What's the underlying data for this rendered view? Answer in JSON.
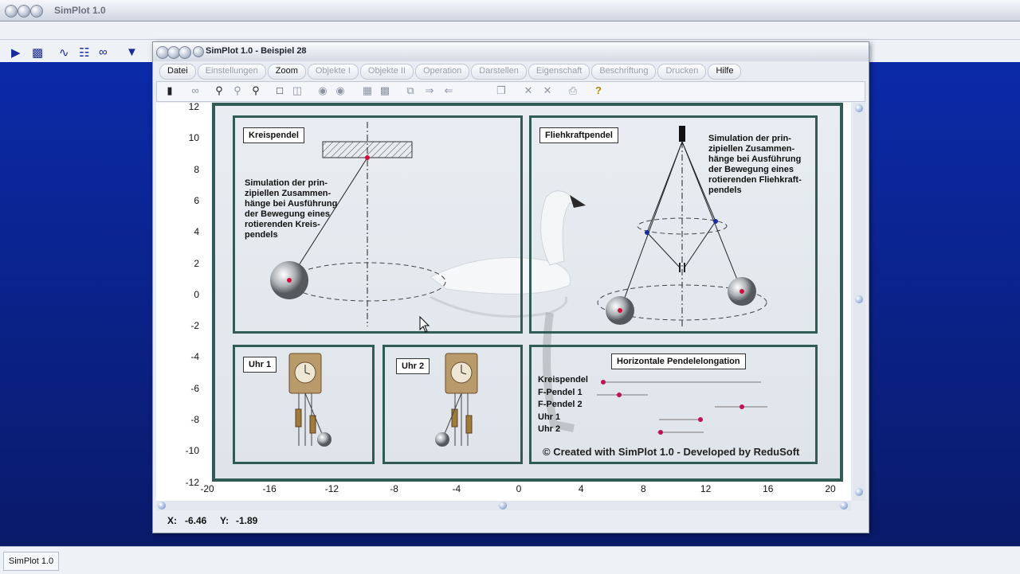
{
  "outer": {
    "title": "SimPlot 1.0"
  },
  "window": {
    "title": "SimPlot 1.0 - Beispiel 28"
  },
  "menu": [
    {
      "label": "Datei",
      "active": true
    },
    {
      "label": "Einstellungen",
      "active": false
    },
    {
      "label": "Zoom",
      "active": true
    },
    {
      "label": "Objekte I",
      "active": false
    },
    {
      "label": "Objekte II",
      "active": false
    },
    {
      "label": "Operation",
      "active": false
    },
    {
      "label": "Darstellen",
      "active": false
    },
    {
      "label": "Eigenschaft",
      "active": false
    },
    {
      "label": "Beschriftung",
      "active": false
    },
    {
      "label": "Drucken",
      "active": false
    },
    {
      "label": "Hilfe",
      "active": true
    }
  ],
  "axes": {
    "x_ticks": [
      "-20",
      "-16",
      "-12",
      "-8",
      "-4",
      "0",
      "4",
      "8",
      "12",
      "16",
      "20"
    ],
    "y_ticks": [
      "12",
      "10",
      "8",
      "6",
      "4",
      "2",
      "0",
      "-2",
      "-4",
      "-6",
      "-8",
      "-10",
      "-12"
    ]
  },
  "panels": {
    "kreis": {
      "label": "Kreispendel",
      "text": [
        "Simulation der prin-",
        "zipiellen Zusammen-",
        "hänge bei Ausführung",
        "der Bewegung eines",
        "rotierenden Kreis-",
        "pendels"
      ]
    },
    "flieh": {
      "label": "Fliehkraftpendel",
      "text": [
        "Simulation der prin-",
        "zipiellen Zusammen-",
        "hänge bei Ausführung",
        "der Bewegung eines",
        "rotierenden Fliehkraft-",
        "pendels"
      ]
    },
    "uhr1": {
      "label": "Uhr 1"
    },
    "uhr2": {
      "label": "Uhr 2"
    },
    "horiz": {
      "label": "Horizontale Pendelelongation",
      "rows": [
        "Kreispendel",
        "F-Pendel 1",
        "F-Pendel 2",
        "Uhr 1",
        "Uhr 2"
      ]
    },
    "credit": "© Created with SimPlot 1.0 - Developed by ReduSoft"
  },
  "status": {
    "x_label": "X:",
    "x_value": "-6.46",
    "y_label": "Y:",
    "y_value": "-1.89"
  },
  "taskbar": {
    "item": "SimPlot 1.0"
  },
  "colors": {
    "frame": "#315c55",
    "desktop": "#0b2aa8",
    "dot": "#d0103a"
  }
}
